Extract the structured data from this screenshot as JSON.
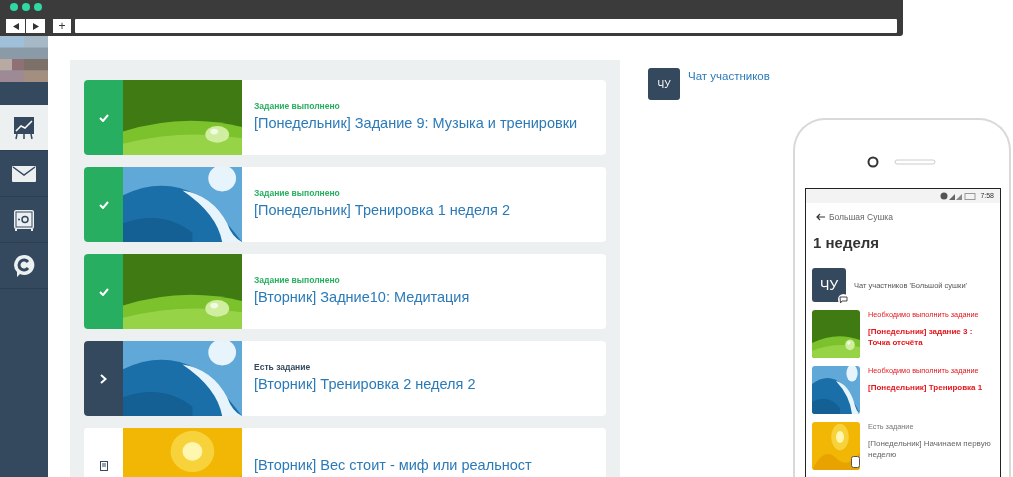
{
  "browser": {
    "new_tab": "+"
  },
  "sidebar": {
    "items": [
      {
        "selected": true
      },
      {
        "selected": false
      },
      {
        "selected": false
      },
      {
        "selected": false
      }
    ]
  },
  "tasks": [
    {
      "kind": "done",
      "status_text": "Задание выполнено",
      "title": "[Понедельник] Задание 9: Музыка и тренировки"
    },
    {
      "kind": "done",
      "status_text": "Задание выполнено",
      "title": "[Понедельник] Тренировка 1 неделя 2"
    },
    {
      "kind": "done",
      "status_text": "Задание выполнено",
      "title": "[Вторник] Задние10: Медитация"
    },
    {
      "kind": "open",
      "status_text": "Есть задание",
      "title": "[Вторник] Тренировка 2 неделя 2"
    },
    {
      "kind": "locked",
      "title": "[Вторник] Вес стоит - миф или реальност"
    }
  ],
  "chat": {
    "avatar": "ЧУ",
    "title": "Чат участников"
  },
  "phone": {
    "time": "7:58",
    "back_label": "Большая Сушка",
    "heading": "1 неделя",
    "chat": {
      "avatar": "ЧУ",
      "title": "Чат участников 'Большой сушки'"
    },
    "items": [
      {
        "kind": "required",
        "status_text": "Необходимо выполнить задание",
        "title": "[Понедельник] задание 3 : Точка отсчёта"
      },
      {
        "kind": "required",
        "status_text": "Необходимо выполнить задание",
        "title": "[Понедельник] Тренировка 1"
      },
      {
        "kind": "available",
        "status_text": "Есть задание",
        "title": "[Понедельник] Начинаем первую неделю"
      }
    ]
  }
}
